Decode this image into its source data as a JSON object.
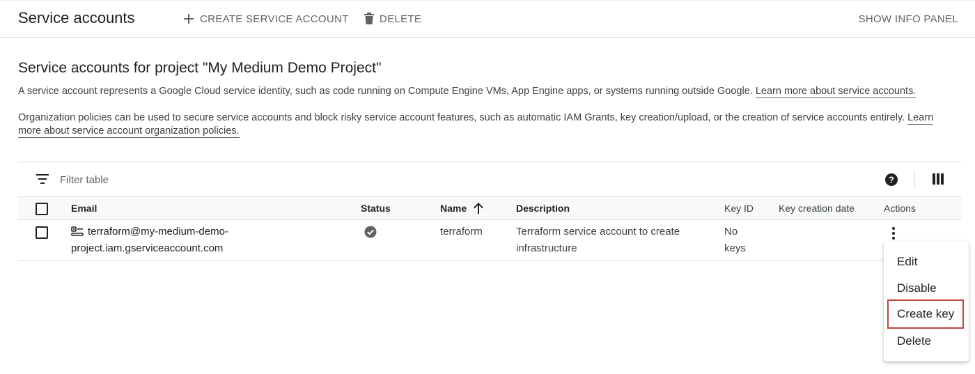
{
  "header": {
    "title": "Service accounts",
    "create_label": "CREATE SERVICE ACCOUNT",
    "delete_label": "DELETE",
    "info_label": "SHOW INFO PANEL"
  },
  "intro": {
    "heading": "Service accounts for project \"My Medium Demo Project\"",
    "para1": "A service account represents a Google Cloud service identity, such as code running on Compute Engine VMs, App Engine apps, or systems running outside Google.",
    "para1_link": "Learn more about service accounts.",
    "para2": "Organization policies can be used to secure service accounts and block risky service account features, such as automatic IAM Grants, key creation/upload, or the creation of service accounts entirely.",
    "para2_link": "Learn more about service account organization policies."
  },
  "table": {
    "filter_placeholder": "Filter table",
    "columns": {
      "email": "Email",
      "status": "Status",
      "name": "Name",
      "description": "Description",
      "key_id": "Key ID",
      "key_creation_date": "Key creation date",
      "actions": "Actions"
    },
    "rows": [
      {
        "email": "terraform@my-medium-demo-project.iam.gserviceaccount.com",
        "status": "enabled",
        "name": "terraform",
        "description": "Terraform service account to create infrastructure",
        "key_id": "No keys",
        "key_creation_date": ""
      }
    ]
  },
  "menu": {
    "items": [
      "Edit",
      "Disable",
      "Create key",
      "Delete"
    ],
    "highlighted_item": "Create key"
  },
  "colors": {
    "text": "#202124",
    "secondary": "#5f6368",
    "highlight_border": "#c5443a"
  },
  "icons": [
    "add-icon",
    "trash-icon",
    "filter-icon",
    "help-icon",
    "columns-icon",
    "arrow-up-icon",
    "service-account-icon",
    "check-circle-icon",
    "more-vert-icon"
  ]
}
